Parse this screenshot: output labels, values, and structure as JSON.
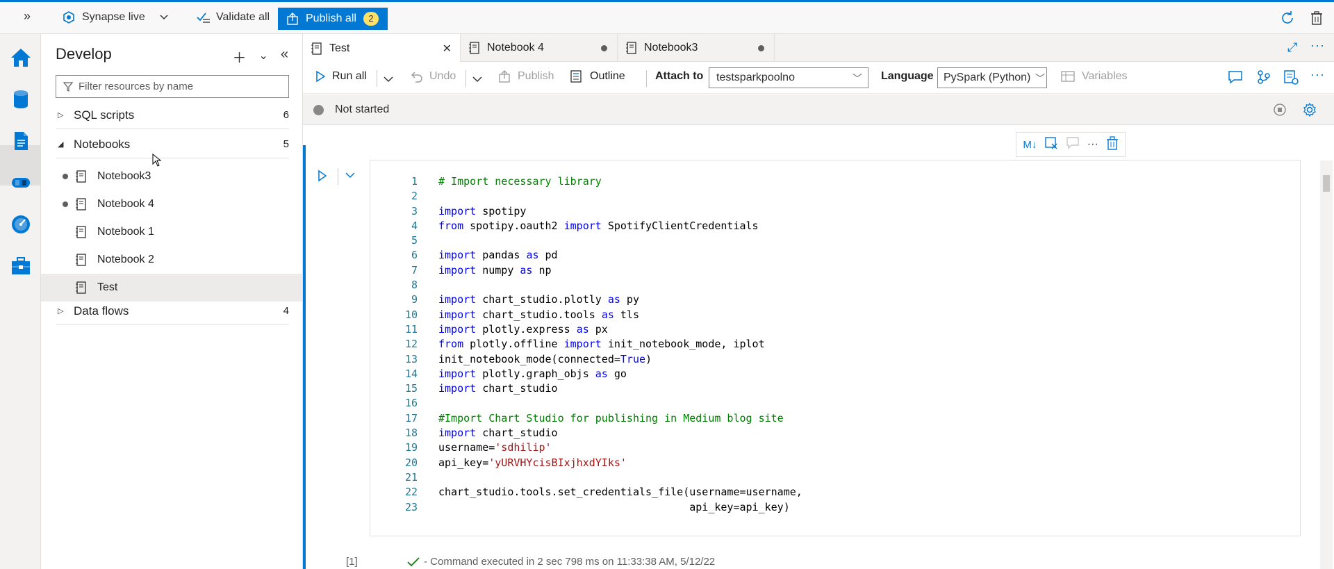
{
  "topbar": {
    "workspace_label": "Synapse live",
    "validate_label": "Validate all",
    "publish_label": "Publish all",
    "publish_count": "2"
  },
  "develop": {
    "title": "Develop",
    "filter_placeholder": "Filter resources by name",
    "groups": [
      {
        "label": "SQL scripts",
        "count": "6"
      },
      {
        "label": "Notebooks",
        "count": "5"
      },
      {
        "label": "Data flows",
        "count": "4"
      }
    ],
    "notebooks": [
      {
        "label": "Notebook3",
        "unsaved": true
      },
      {
        "label": "Notebook 4",
        "unsaved": true
      },
      {
        "label": "Notebook 1",
        "unsaved": false
      },
      {
        "label": "Notebook 2",
        "unsaved": false
      },
      {
        "label": "Test",
        "unsaved": false,
        "selected": true
      }
    ]
  },
  "tabs": [
    {
      "label": "Test",
      "active": true
    },
    {
      "label": "Notebook 4",
      "active": false
    },
    {
      "label": "Notebook3",
      "active": false
    }
  ],
  "toolbar": {
    "run_all": "Run all",
    "undo": "Undo",
    "publish": "Publish",
    "outline": "Outline",
    "attach_label": "Attach to",
    "attach_value": "testsparkpoolno",
    "language_label": "Language",
    "language_value": "PySpark (Python)",
    "variables": "Variables"
  },
  "status": {
    "text": "Not started"
  },
  "cell": {
    "exec_count": "[1]",
    "result": "- Command executed in 2 sec 798 ms on 11:33:38 AM, 5/12/22",
    "more": "...",
    "code_lines": [
      "# Import necessary library",
      "",
      "import spotipy",
      "from spotipy.oauth2 import SpotifyClientCredentials",
      "",
      "import pandas as pd",
      "import numpy as np",
      "",
      "import chart_studio.plotly as py",
      "import chart_studio.tools as tls",
      "import plotly.express as px",
      "from plotly.offline import init_notebook_mode, iplot",
      "init_notebook_mode(connected=True)",
      "import plotly.graph_objs as go",
      "import chart_studio",
      "",
      "#Import Chart Studio for publishing in Medium blog site",
      "import chart_studio",
      "username='sdhilip'",
      "api_key='yURVHYcisBIxjhxdYIks'",
      "",
      "chart_studio.tools.set_credentials_file(username=username,",
      "                                        api_key=api_key)"
    ]
  },
  "colors": {
    "accent": "#0078d4",
    "badge": "#ffe066"
  }
}
